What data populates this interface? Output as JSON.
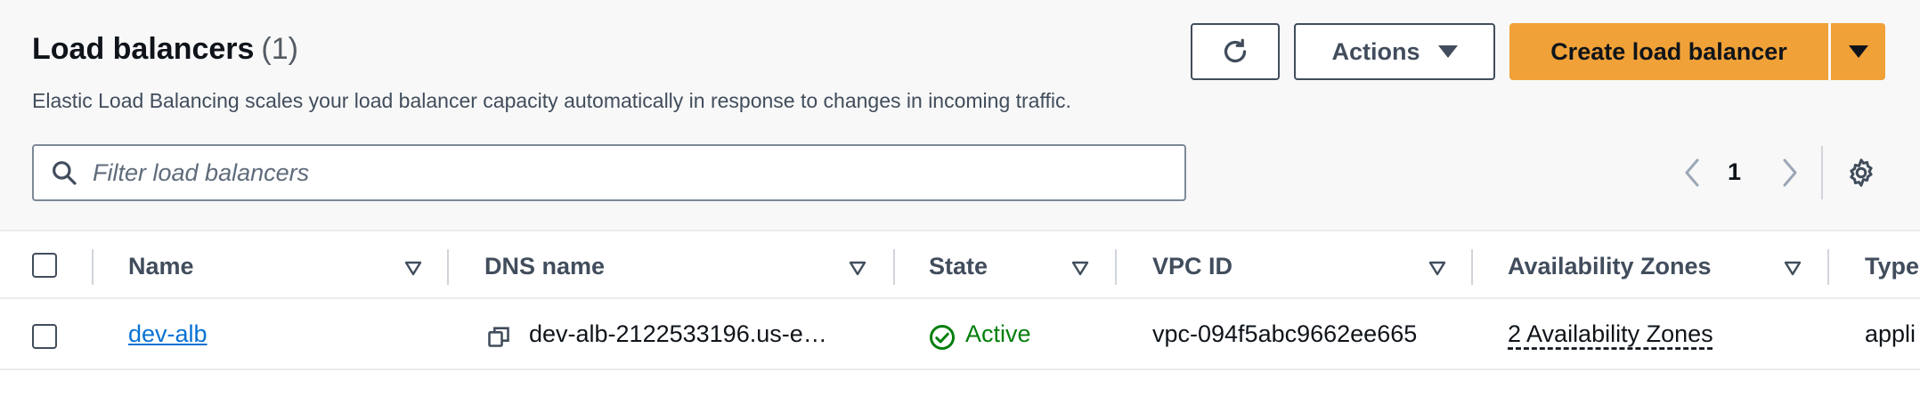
{
  "header": {
    "title": "Load balancers",
    "count": "(1)",
    "description": "Elastic Load Balancing scales your load balancer capacity automatically in response to changes in incoming traffic."
  },
  "toolbar": {
    "refresh_icon": "refresh-icon",
    "actions_label": "Actions",
    "create_label": "Create load balancer"
  },
  "search": {
    "placeholder": "Filter load balancers"
  },
  "pagination": {
    "current_page": "1"
  },
  "table": {
    "columns": [
      "Name",
      "DNS name",
      "State",
      "VPC ID",
      "Availability Zones",
      "Type"
    ],
    "rows": [
      {
        "name": "dev-alb",
        "dns_name": "dev-alb-2122533196.us-e…",
        "state": "Active",
        "vpc_id": "vpc-094f5abc9662ee665",
        "availability_zones": "2 Availability Zones",
        "type": "appli"
      }
    ]
  },
  "colors": {
    "primary_button": "#f0a138",
    "link": "#0972d3",
    "success": "#037f0c"
  }
}
